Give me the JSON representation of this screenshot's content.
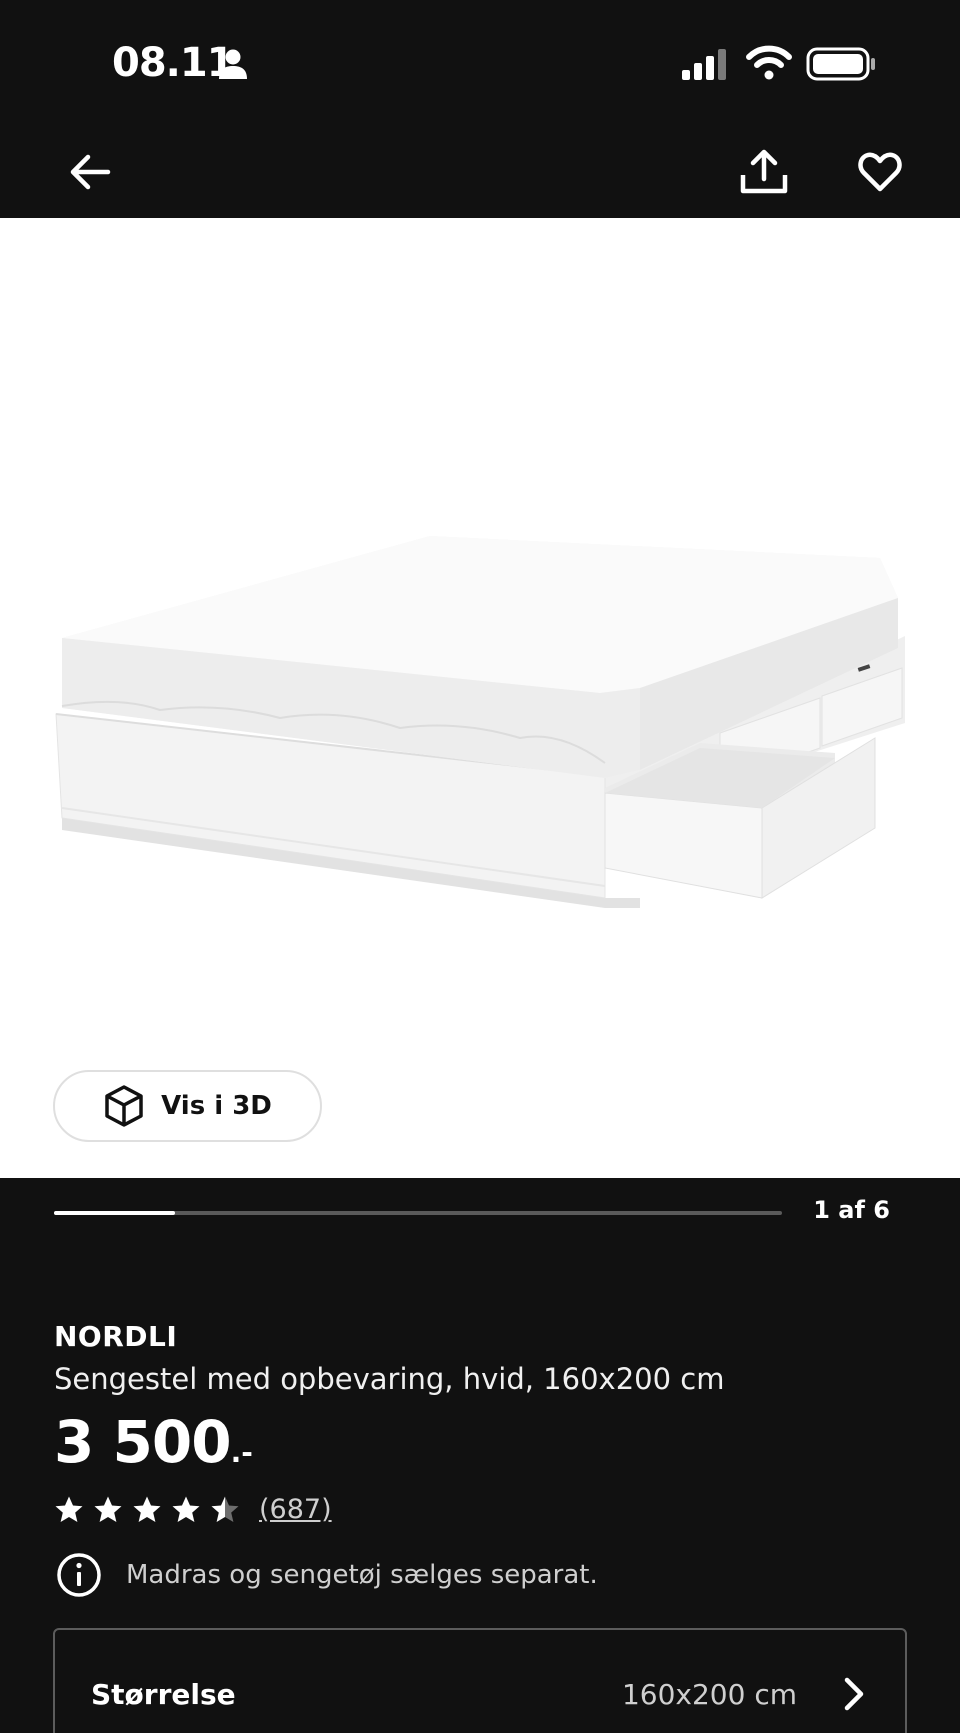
{
  "status_bar": {
    "time": "08.11",
    "icons": [
      "person-icon",
      "signal-icon",
      "wifi-icon",
      "battery-icon"
    ]
  },
  "nav": {
    "icons": [
      "arrow-left-icon",
      "share-icon",
      "heart-icon"
    ]
  },
  "gallery": {
    "view_3d_label": "Vis i 3D",
    "pager_text": "1 af 6",
    "progress": 0.166
  },
  "product": {
    "brand": "NORDLI",
    "description": "Sengestel med opbevaring, hvid, 160x200 cm",
    "price_main": "3 500",
    "price_suffix": ".-",
    "rating": 4.5,
    "rating_max": 5,
    "review_count": "(687)",
    "notice": "Madras og sengetøj sælges separat."
  },
  "size_selector": {
    "label": "Størrelse",
    "value": "160x200 cm"
  },
  "colors": {
    "background": "#111111",
    "image_bg": "#ffffff",
    "text_primary": "#ffffff",
    "text_secondary": "#cfcfcf"
  }
}
